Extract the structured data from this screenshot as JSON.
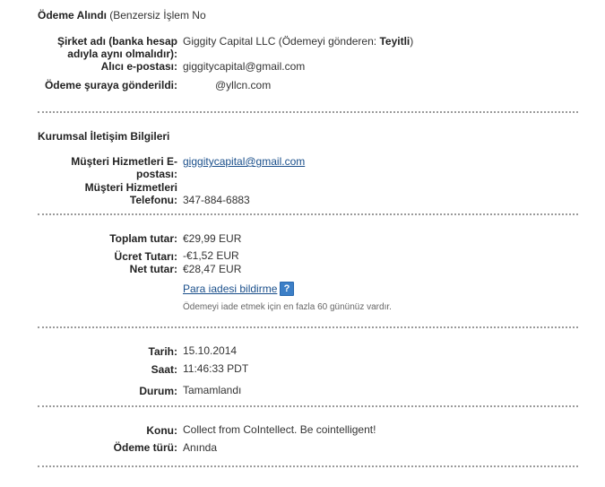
{
  "header": {
    "title": "Ödeme Alındı",
    "subtitle": "(Benzersiz İşlem No"
  },
  "recipient": {
    "company_label_line1": "Şirket adı (banka hesap",
    "company_label_line2": "adıyla aynı olmalıdır):",
    "company_value_prefix": "Giggity Capital LLC (Ödemeyi gönderen: ",
    "company_value_status": "Teyitli",
    "company_value_suffix": ")",
    "email_label": "Alıcı e-postası:",
    "email_value": "giggitycapital@gmail.com",
    "sent_to_label": "Ödeme şuraya gönderildi:",
    "sent_to_value": "@yllcn.com"
  },
  "contact": {
    "section_title": "Kurumsal İletişim Bilgileri",
    "cs_email_label_line1": "Müşteri Hizmetleri E-",
    "cs_email_label_line2": "postası:",
    "cs_email_value": "giggitycapital@gmail.com",
    "cs_phone_label_line1": "Müşteri Hizmetleri",
    "cs_phone_label_line2": "Telefonu:",
    "cs_phone_value": "347-884-6883"
  },
  "amounts": {
    "total_label": "Toplam tutar:",
    "total_value": "€29,99 EUR",
    "fee_label": "Ücret Tutarı:",
    "fee_value": "-€1,52 EUR",
    "net_label": "Net tutar:",
    "net_value": "€28,47 EUR",
    "refund_link": "Para iadesi bildirme",
    "help_icon_glyph": "?",
    "refund_note": "Ödemeyi iade etmek için en fazla 60 gününüz vardır."
  },
  "details": {
    "date_label": "Tarih:",
    "date_value": "15.10.2014",
    "time_label": "Saat:",
    "time_value": "11:46:33 PDT",
    "status_label": "Durum:",
    "status_value": "Tamamlandı"
  },
  "payment": {
    "subject_label": "Konu:",
    "subject_value": "Collect from CoIntellect. Be cointelligent!",
    "type_label": "Ödeme türü:",
    "type_value": "Anında"
  },
  "colors": {
    "link": "#1a4f8b",
    "help_icon": "#3c7fc7",
    "separator": "#9a9a9a"
  }
}
